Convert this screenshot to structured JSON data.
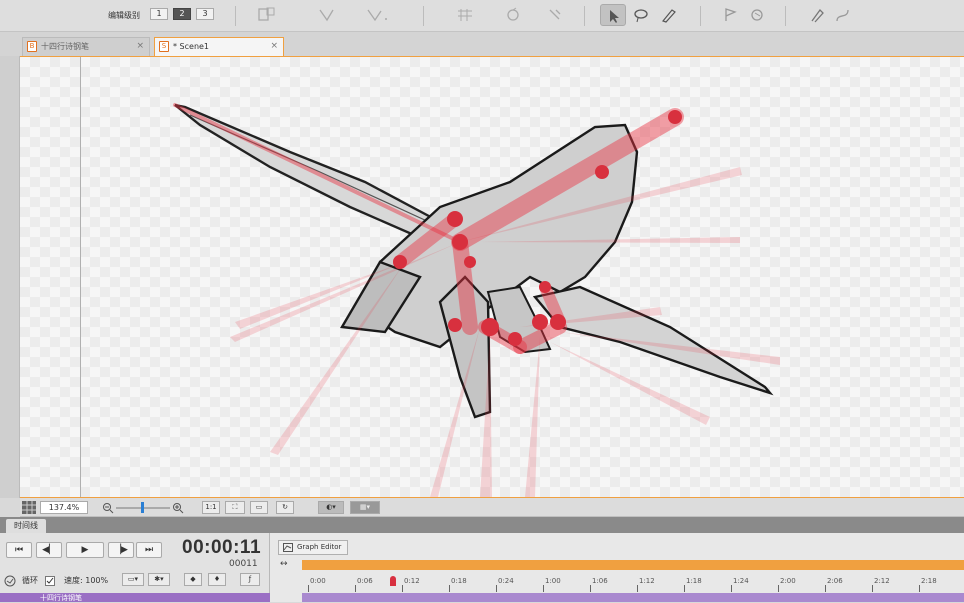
{
  "toolbar": {
    "level_label": "编辑级别",
    "levels": [
      "1",
      "2",
      "3"
    ]
  },
  "tabs": [
    {
      "label": "十四行诗钢笔",
      "active": false,
      "close": "×"
    },
    {
      "label": "* Scene1",
      "active": true,
      "close": "×"
    }
  ],
  "statusbar": {
    "zoom": "137.4%",
    "fit_label": "1:1"
  },
  "timeline": {
    "panel_tab": "时间线",
    "timecode": "00:00:11",
    "frame": "00011",
    "loop_label": "循环",
    "speed_label": "速度: 100%",
    "graph_editor_label": "Graph Editor",
    "layer_name": "十四行诗钢笔",
    "ruler_labels": [
      "0:00",
      "0:06",
      "0:12",
      "0:18",
      "0:24",
      "1:00",
      "1:06",
      "1:12",
      "1:18",
      "1:24",
      "2:00",
      "2:06",
      "2:12",
      "2:18"
    ]
  },
  "colors": {
    "accent": "#f0a040",
    "bone": "#e83040",
    "layer": "#9a6fc4"
  }
}
